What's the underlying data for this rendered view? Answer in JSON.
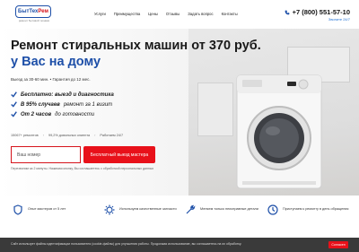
{
  "header": {
    "logo_main": "БытТех",
    "logo_accent": "Рем",
    "logo_sub": "ремонт бытовой техники",
    "nav": [
      "Услуги",
      "Преимущества",
      "Цены",
      "Отзывы",
      "Задать вопрос",
      "Контакты"
    ],
    "phone": "+7 (800) 551-57-10",
    "callme": "Звоните 24/7"
  },
  "hero": {
    "title": "Ремонт стиральных машин от 370 руб.",
    "subtitle": "у Вас на дому",
    "meta": "Выезд за 30-60 мин. • Гарантия до 12 мес.",
    "benefits": [
      {
        "bold": "Бесплатно: выезд и диагностика",
        "rest": ""
      },
      {
        "bold": "В 95% случаев",
        "rest": "ремонт за 1 визит"
      },
      {
        "bold": "От 2 часов",
        "rest": "до готовности"
      }
    ],
    "stats": [
      "15067+ ремонтов",
      "99,2% довольных клиента",
      "Работаем 24/7"
    ],
    "phone_placeholder": "Ваш номер",
    "cta_label": "Бесплатный выезд мастера",
    "note": "Перезвоним за 2 минуты. Нажимая кнопку, Вы соглашаетесь с обработкой персональных данных"
  },
  "features": [
    {
      "icon": "shield-icon",
      "text": "Опыт мастеров от 5 лет"
    },
    {
      "icon": "gear-icon",
      "text": "Используем качественные запчасти"
    },
    {
      "icon": "wrench-icon",
      "text": "Меняем только неисправные детали"
    },
    {
      "icon": "clock-icon",
      "text": "Приступаем к ремонту в день обращения"
    }
  ],
  "cookie": {
    "text": "Сайт использует файлы идентификации пользователя (cookie-файлы) для улучшения работы. Продолжая использование, вы соглашаетесь на их обработку.",
    "button": "Согласен"
  },
  "colors": {
    "brand_blue": "#1d4fa8",
    "accent_red": "#e8111a"
  }
}
